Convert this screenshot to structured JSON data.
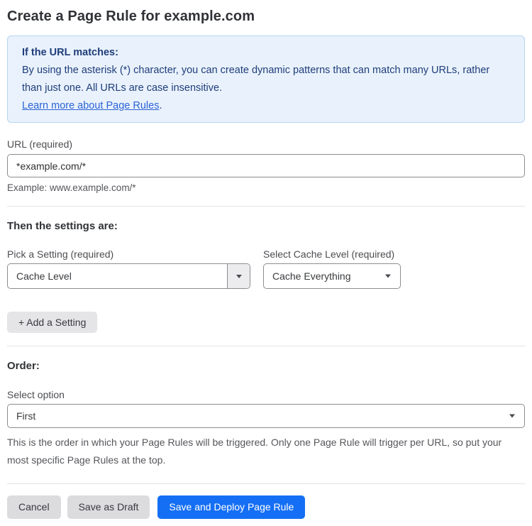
{
  "page": {
    "title": "Create a Page Rule for example.com"
  },
  "info_box": {
    "heading": "If the URL matches:",
    "body": "By using the asterisk (*) character, you can create dynamic patterns that can match many URLs, rather than just one. All URLs are case insensitive.",
    "link_label": "Learn more about Page Rules",
    "link_suffix": "."
  },
  "url_field": {
    "label": "URL (required)",
    "value": "*example.com/*",
    "helper": "Example: www.example.com/*"
  },
  "settings_section": {
    "heading": "Then the settings are:",
    "setting_select": {
      "label": "Pick a Setting (required)",
      "value": "Cache Level"
    },
    "cache_level_select": {
      "label": "Select Cache Level (required)",
      "value": "Cache Everything"
    },
    "add_setting_label": "+ Add a Setting"
  },
  "order_section": {
    "heading": "Order:",
    "select_label": "Select option",
    "value": "First",
    "helper": "This is the order in which your Page Rules will be triggered. Only one Page Rule will trigger per URL, so put your most specific Page Rules at the top."
  },
  "actions": {
    "cancel": "Cancel",
    "save_draft": "Save as Draft",
    "save_deploy": "Save and Deploy Page Rule"
  },
  "colors": {
    "accent_blue": "#156ff5",
    "info_bg": "#e9f2fc",
    "info_border": "#b5d3f1",
    "info_text": "#1f3d7a",
    "link_blue": "#2c63d6"
  }
}
